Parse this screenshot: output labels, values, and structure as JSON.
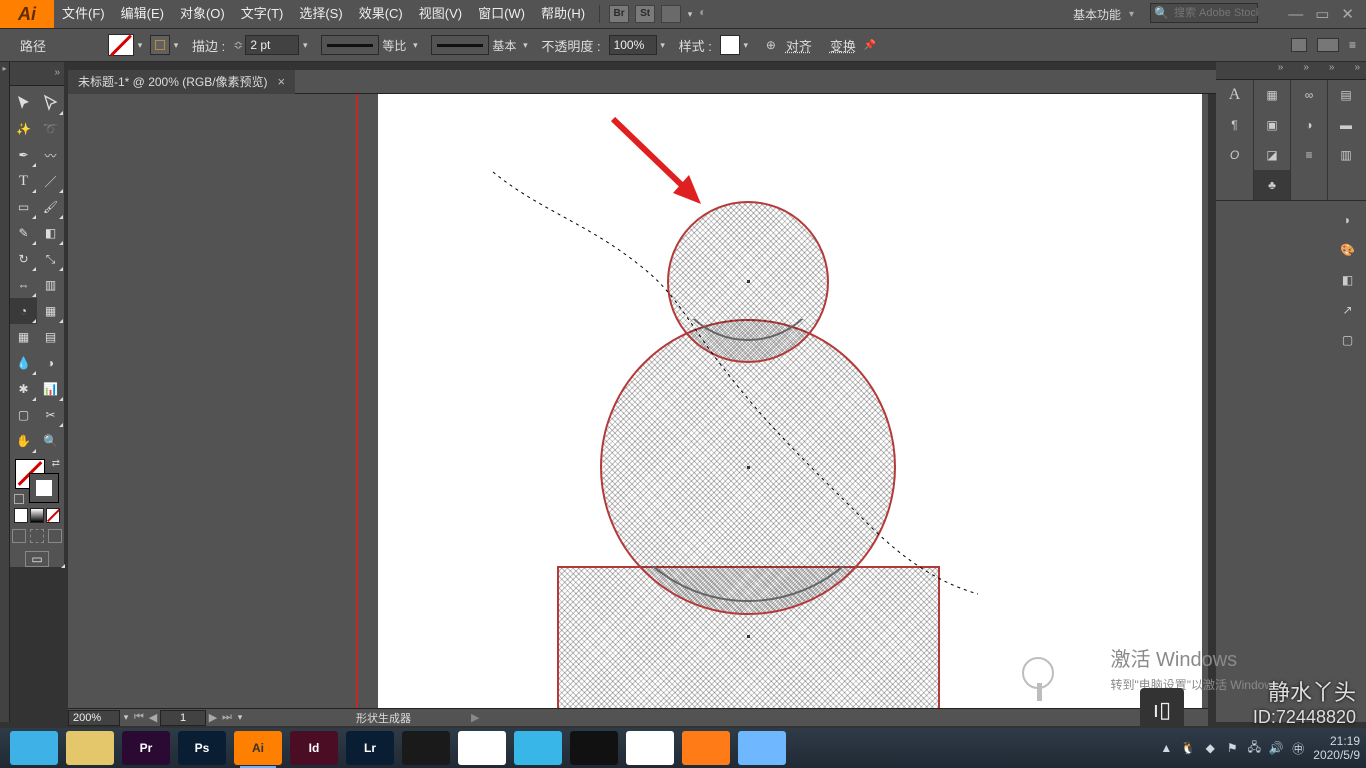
{
  "app": {
    "logo_text": "Ai"
  },
  "menus": {
    "file": "文件(F)",
    "edit": "编辑(E)",
    "object": "对象(O)",
    "type": "文字(T)",
    "select": "选择(S)",
    "effect": "效果(C)",
    "view": "视图(V)",
    "window": "窗口(W)",
    "help": "帮助(H)"
  },
  "workspace": {
    "label": "基本功能"
  },
  "search": {
    "placeholder": "搜索 Adobe Stock"
  },
  "optbar": {
    "path_label": "路径",
    "stroke_label": "描边 :",
    "stroke_value": "2 pt",
    "profile_label": "等比",
    "brush_label": "基本",
    "opacity_label": "不透明度 :",
    "opacity_value": "100%",
    "style_label": "样式 :",
    "align_label": "对齐",
    "transform_label": "变换"
  },
  "document": {
    "tab_title": "未标题-1* @ 200% (RGB/像素预览)"
  },
  "status": {
    "zoom": "200%",
    "artboard_num": "1",
    "tool": "形状生成器",
    "playhead": "▶"
  },
  "watermark": {
    "line1": "激活 Windows",
    "line2": "转到\"电脑设置\"以激活 Windows。"
  },
  "author": {
    "line1": "静水丫头",
    "line2": "ID:72448820"
  },
  "tray": {
    "time": "21:19",
    "date": "2020/5/9"
  },
  "taskbar_apps": [
    {
      "label": "",
      "bg": "#3eb2e6"
    },
    {
      "label": "",
      "bg": "#e4c76a"
    },
    {
      "label": "Pr",
      "bg": "#2a0a33"
    },
    {
      "label": "Ps",
      "bg": "#0a1e33"
    },
    {
      "label": "Ai",
      "bg": "#ff7f00",
      "active": true
    },
    {
      "label": "Id",
      "bg": "#4a0d24"
    },
    {
      "label": "Lr",
      "bg": "#0a1e33"
    },
    {
      "label": "",
      "bg": "#1a1a1a"
    },
    {
      "label": "",
      "bg": "#ffffff"
    },
    {
      "label": "",
      "bg": "#39b6e8"
    },
    {
      "label": "",
      "bg": "#111111"
    },
    {
      "label": "",
      "bg": "#ffffff"
    },
    {
      "label": "",
      "bg": "#ff7b18"
    },
    {
      "label": "",
      "bg": "#6fb7ff"
    }
  ]
}
